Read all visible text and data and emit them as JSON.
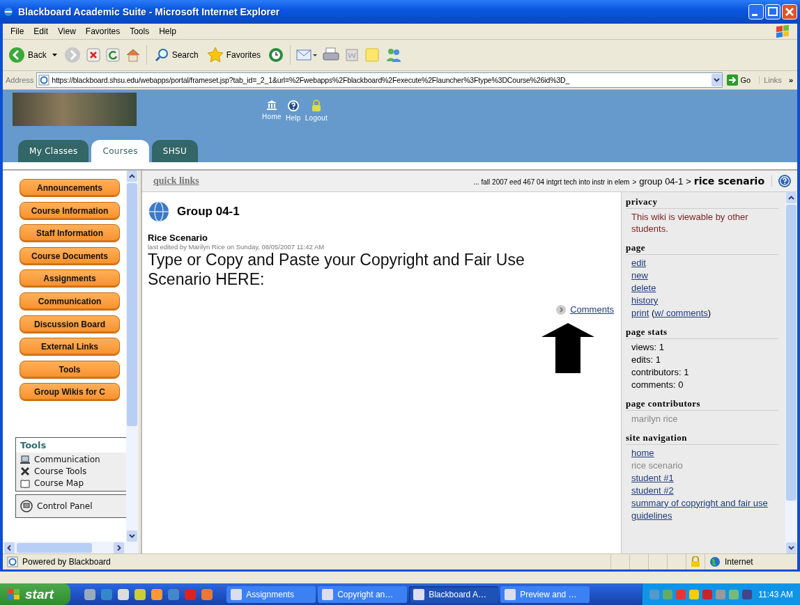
{
  "window": {
    "title": "Blackboard Academic Suite - Microsoft Internet Explorer"
  },
  "menu": [
    "File",
    "Edit",
    "View",
    "Favorites",
    "Tools",
    "Help"
  ],
  "toolbar": {
    "back": "Back",
    "search": "Search",
    "favorites": "Favorites"
  },
  "address_bar": {
    "label": "Address",
    "url": "https://blackboard.shsu.edu/webapps/portal/frameset.jsp?tab_id=_2_1&url=%2Fwebapps%2Fblackboard%2Fexecute%2Flauncher%3Ftype%3DCourse%26id%3D_",
    "go": "Go",
    "links": "Links",
    "more": "»"
  },
  "banner": {
    "nav": [
      "Home",
      "Help",
      "Logout"
    ],
    "tabs": [
      {
        "label": "My Classes",
        "selected": false
      },
      {
        "label": "Courses",
        "selected": true
      },
      {
        "label": "SHSU",
        "selected": false
      }
    ]
  },
  "course_menu": [
    "Announcements",
    "Course Information",
    "Staff Information",
    "Course Documents",
    "Assignments",
    "Communication",
    "Discussion Board",
    "External Links",
    "Tools",
    "Group Wikis for C"
  ],
  "tools_panel": {
    "title": "Tools",
    "items": [
      "Communication",
      "Course Tools",
      "Course Map"
    ],
    "control_panel": "Control Panel"
  },
  "header": {
    "quick_links": "quick links",
    "breadcrumb": [
      {
        "text": "... fall 2007 eed 467 04 intgrt tech into instr in elem",
        "kind": "small"
      },
      {
        "text": ">",
        "kind": "small"
      },
      {
        "text": "group 04-1",
        "kind": "mid"
      },
      {
        "text": ">",
        "kind": "mid"
      },
      {
        "text": "rice scenario",
        "kind": "current"
      }
    ]
  },
  "wiki": {
    "title": "Group 04-1",
    "page_title": "Rice Scenario",
    "last_edited": "last edited by Marilyn Rice on Sunday, 08/05/2007 11:42 AM",
    "body": "Type or Copy and Paste your Copyright and Fair Use Scenario HERE:",
    "comments": "Comments"
  },
  "sidebar": {
    "privacy": {
      "heading": "privacy",
      "text": "This wiki is viewable by other students."
    },
    "page": {
      "heading": "page",
      "links": [
        "edit",
        "new",
        "delete",
        "history"
      ],
      "print": "print",
      "open": "(",
      "print_comments": "w/ comments",
      "close": ")"
    },
    "stats": {
      "heading": "page stats",
      "lines": [
        "views: 1",
        "edits: 1",
        "contributors: 1",
        "comments: 0"
      ]
    },
    "contributors": {
      "heading": "page contributors",
      "names": [
        "marilyn rice"
      ]
    },
    "navigation": {
      "heading": "site navigation",
      "items": [
        {
          "text": "home",
          "current": false
        },
        {
          "text": "rice scenario",
          "current": true
        },
        {
          "text": "student #1",
          "current": false
        },
        {
          "text": "student #2",
          "current": false
        },
        {
          "text": "summary of copyright and fair use guidelines",
          "current": false
        }
      ]
    }
  },
  "status_bar": {
    "text": "Powered by Blackboard",
    "zone": "Internet"
  },
  "taskbar": {
    "start": "start",
    "tasks": [
      {
        "label": "Assignments",
        "selected": false
      },
      {
        "label": "Copyright an…",
        "selected": false
      },
      {
        "label": "Blackboard A…",
        "selected": true
      },
      {
        "label": "Preview and …",
        "selected": false
      }
    ],
    "clock": "11:43 AM"
  }
}
